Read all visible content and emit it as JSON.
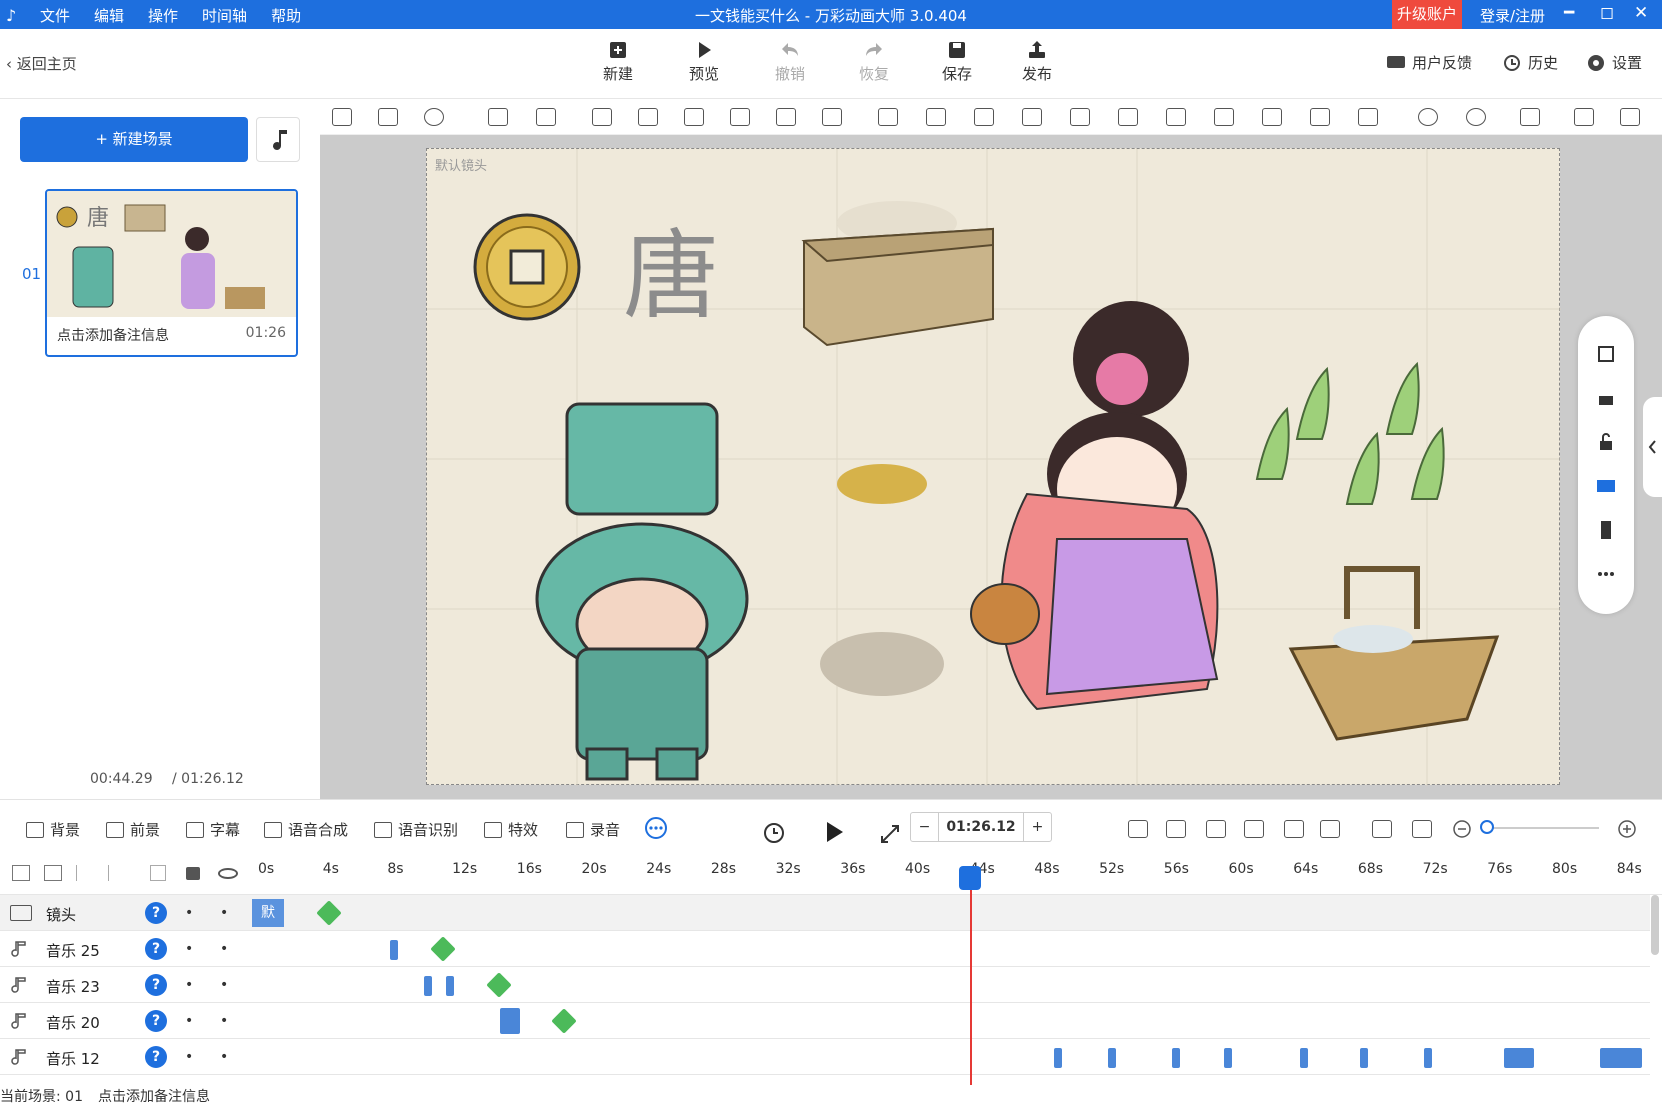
{
  "titlebar": {
    "logo": "♪",
    "menu": [
      "文件",
      "编辑",
      "操作",
      "时间轴",
      "帮助"
    ],
    "title": "一文钱能买什么 - 万彩动画大师 3.0.404",
    "upgrade": "升级账户",
    "login": "登录/注册",
    "min": "━",
    "max": "◻",
    "close": "✕"
  },
  "toolbar": {
    "back": "返回主页",
    "new": "新建",
    "preview": "预览",
    "undo": "撤销",
    "redo": "恢复",
    "save": "保存",
    "publish": "发布",
    "feedback": "用户反馈",
    "history": "历史",
    "settings": "设置"
  },
  "scenes": {
    "new_scene": "+ 新建场景",
    "items": [
      {
        "num": "01",
        "note": "点击添加备注信息",
        "duration": "01:26"
      }
    ],
    "current_time": "00:44.29",
    "total_time": "/ 01:26.12"
  },
  "canvas": {
    "camera_label": "默认镜头",
    "glyph": "唐"
  },
  "bottom_toolbar": {
    "background": "背景",
    "foreground": "前景",
    "subtitle": "字幕",
    "tts": "语音合成",
    "asr": "语音识别",
    "effects": "特效",
    "record": "录音",
    "time": "01:26.12",
    "minus": "−",
    "plus": "+"
  },
  "ruler": [
    "0s",
    "4s",
    "8s",
    "12s",
    "16s",
    "20s",
    "24s",
    "28s",
    "32s",
    "36s",
    "40s",
    "44s",
    "48s",
    "52s",
    "56s",
    "60s",
    "64s",
    "68s",
    "72s",
    "76s",
    "80s",
    "84s"
  ],
  "tracks": [
    {
      "name": "镜头",
      "default_label": "默"
    },
    {
      "name": "音乐 25"
    },
    {
      "name": "音乐 23"
    },
    {
      "name": "音乐 20"
    },
    {
      "name": "音乐 12"
    }
  ],
  "track_help": "?",
  "track_dot": "•",
  "statusbar": {
    "scene": "当前场景: 01",
    "note": "点击添加备注信息"
  },
  "colors": {
    "primary": "#1e6fde",
    "upgrade": "#ef4a3d",
    "keyframe": "#4cba5a",
    "playhead_line": "#e53935"
  }
}
